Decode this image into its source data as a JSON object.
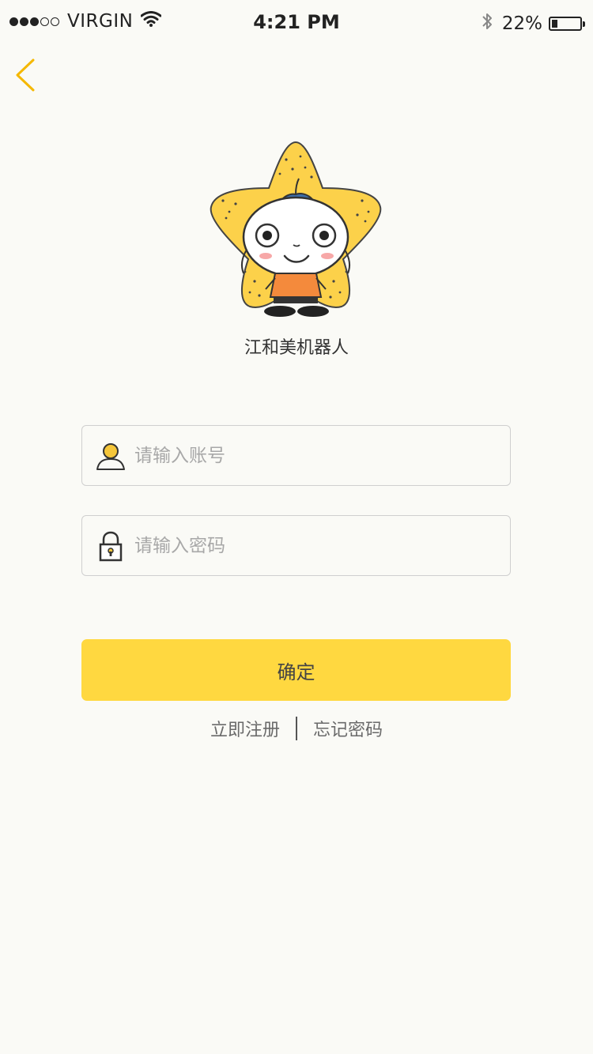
{
  "status_bar": {
    "carrier": "VIRGIN",
    "time": "4:21 PM",
    "battery": "22%",
    "battery_level": 0.22,
    "signal_bars_filled": 3,
    "signal_bars_total": 5,
    "icons": [
      "wifi-icon",
      "bluetooth-icon",
      "battery-icon"
    ]
  },
  "header": {
    "back_icon": "chevron-left-icon"
  },
  "brand": {
    "app_name": "江和美机器人",
    "logo": "star-mascot"
  },
  "login_form": {
    "username": {
      "placeholder": "请输入账号",
      "value": "",
      "icon": "user-icon"
    },
    "password": {
      "placeholder": "请输入密码",
      "value": "",
      "icon": "lock-icon"
    },
    "submit_label": "确定"
  },
  "links": {
    "register": "立即注册",
    "forgot_password": "忘记密码"
  },
  "colors": {
    "background": "#fafaf6",
    "accent": "#ffd840",
    "back_arrow": "#f5b800",
    "field_border": "#cfcfcf",
    "placeholder": "#a8a8a8"
  }
}
